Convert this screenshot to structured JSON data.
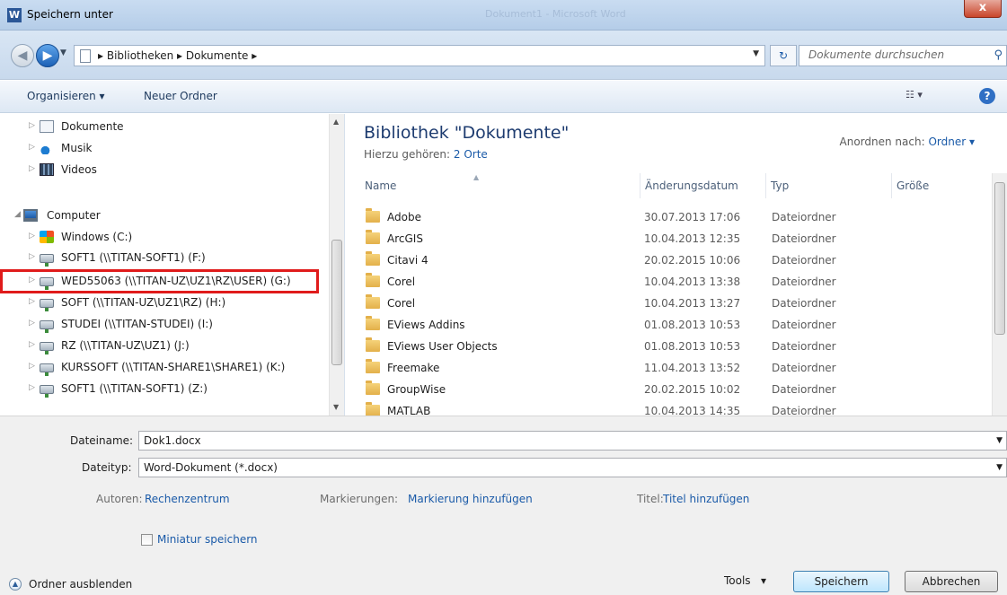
{
  "window": {
    "title": "Speichern unter",
    "app_icon": "W",
    "ghost_title": "Dokument1 - Microsoft Word",
    "close_label": "x"
  },
  "address": {
    "crumbs": "▸  Bibliotheken  ▸  Dokumente  ▸",
    "search_placeholder": "Dokumente durchsuchen"
  },
  "toolbar": {
    "organize": "Organisieren ▾",
    "new_folder": "Neuer Ordner"
  },
  "nav": {
    "items": [
      {
        "label": "Dokumente",
        "icon": "documents-icon"
      },
      {
        "label": "Musik",
        "icon": "music-icon"
      },
      {
        "label": "Videos",
        "icon": "videos-icon"
      },
      {
        "label": "Computer",
        "icon": "computer-icon"
      },
      {
        "label": "Windows (C:)",
        "icon": "windows-drive-icon"
      },
      {
        "label": "SOFT1 (\\\\TITAN-SOFT1) (F:)",
        "icon": "network-drive-icon"
      },
      {
        "label": "WED55063 (\\\\TITAN-UZ\\UZ1\\RZ\\USER) (G:)",
        "icon": "network-drive-icon"
      },
      {
        "label": "SOFT (\\\\TITAN-UZ\\UZ1\\RZ) (H:)",
        "icon": "network-drive-icon"
      },
      {
        "label": "STUDEI (\\\\TITAN-STUDEI) (I:)",
        "icon": "network-drive-icon"
      },
      {
        "label": "RZ (\\\\TITAN-UZ\\UZ1) (J:)",
        "icon": "network-drive-icon"
      },
      {
        "label": "KURSSOFT (\\\\TITAN-SHARE1\\SHARE1) (K:)",
        "icon": "network-drive-icon"
      },
      {
        "label": "SOFT1 (\\\\TITAN-SOFT1) (Z:)",
        "icon": "network-drive-icon"
      }
    ]
  },
  "library": {
    "title": "Bibliothek \"Dokumente\"",
    "sub_prefix": "Hierzu gehören:",
    "sub_link": "2 Orte",
    "arrange_label": "Anordnen nach:",
    "arrange_value": "Ordner ▾"
  },
  "columns": {
    "name": "Name",
    "date": "Änderungsdatum",
    "type": "Typ",
    "size": "Größe"
  },
  "files": [
    {
      "name": "Adobe",
      "date": "30.07.2013 17:06",
      "type": "Dateiordner"
    },
    {
      "name": "ArcGIS",
      "date": "10.04.2013 12:35",
      "type": "Dateiordner"
    },
    {
      "name": "Citavi 4",
      "date": "20.02.2015 10:06",
      "type": "Dateiordner"
    },
    {
      "name": "Corel",
      "date": "10.04.2013 13:38",
      "type": "Dateiordner"
    },
    {
      "name": "Corel",
      "date": "10.04.2013 13:27",
      "type": "Dateiordner"
    },
    {
      "name": "EViews Addins",
      "date": "01.08.2013 10:53",
      "type": "Dateiordner"
    },
    {
      "name": "EViews User Objects",
      "date": "01.08.2013 10:53",
      "type": "Dateiordner"
    },
    {
      "name": "Freemake",
      "date": "11.04.2013 13:52",
      "type": "Dateiordner"
    },
    {
      "name": "GroupWise",
      "date": "20.02.2015 10:02",
      "type": "Dateiordner"
    },
    {
      "name": "MATLAB",
      "date": "10.04.2013 14:35",
      "type": "Dateiordner"
    }
  ],
  "form": {
    "filename_label": "Dateiname:",
    "filename_value": "Dok1.docx",
    "filetype_label": "Dateityp:",
    "filetype_value": "Word-Dokument (*.docx)",
    "authors_label": "Autoren:",
    "authors_value": "Rechenzentrum",
    "tags_label": "Markierungen:",
    "tags_value": "Markierung hinzufügen",
    "title_label": "Titel:",
    "title_value": "Titel hinzufügen",
    "thumbnail_label": "Miniatur speichern",
    "hide_folders": "Ordner ausblenden",
    "tools": "Tools",
    "save": "Speichern",
    "cancel": "Abbrechen"
  },
  "colors": {
    "highlight": "#e01b1b",
    "link": "#1a5aa8",
    "library_title": "#1e3c70"
  }
}
